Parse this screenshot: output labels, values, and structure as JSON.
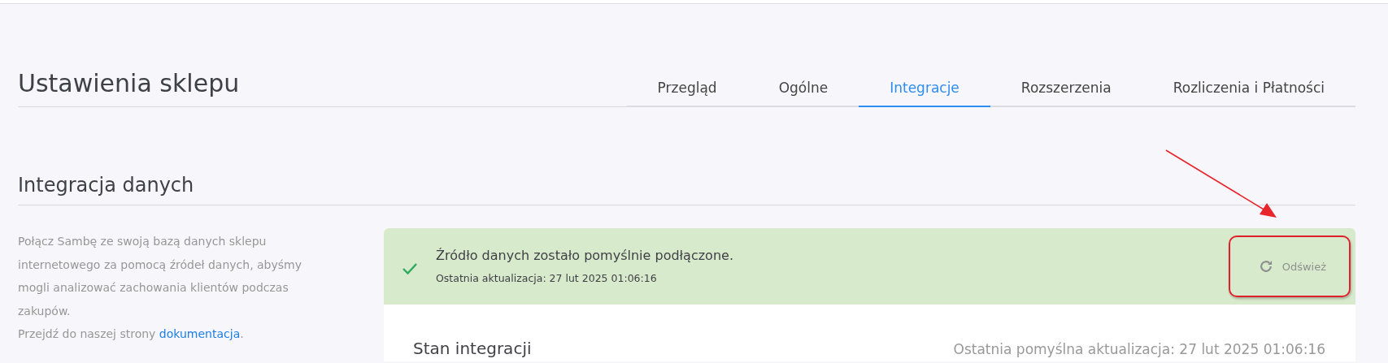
{
  "page_title": "Ustawienia sklepu",
  "tabs": [
    {
      "label": "Przegląd",
      "selected": false
    },
    {
      "label": "Ogólne",
      "selected": false
    },
    {
      "label": "Integracje",
      "selected": true
    },
    {
      "label": "Rozszerzenia",
      "selected": false
    },
    {
      "label": "Rozliczenia i Płatności",
      "selected": false
    }
  ],
  "section": {
    "heading": "Integracja danych",
    "description": "Połącz Sambę ze swoją bazą danych sklepu internetowego za pomocą źródeł danych, abyśmy mogli analizować zachowania klientów podczas zakupów.",
    "doc_prefix": "Przejdź do naszej strony ",
    "doc_link": "dokumentacja",
    "doc_suffix": "."
  },
  "banner": {
    "kind": "success",
    "message": "Źródło danych zostało pomyślnie podłączone.",
    "updated": "Ostatnia aktualizacja: 27 lut 2025 01:06:16",
    "button": "Odśwież"
  },
  "status": {
    "heading": "Stan integracji",
    "last_success": "Ostatnia pomyślna aktualizacja: 27 lut 2025 01:06:16"
  },
  "annotations": {
    "arrow": true,
    "highlight_frame": true
  }
}
